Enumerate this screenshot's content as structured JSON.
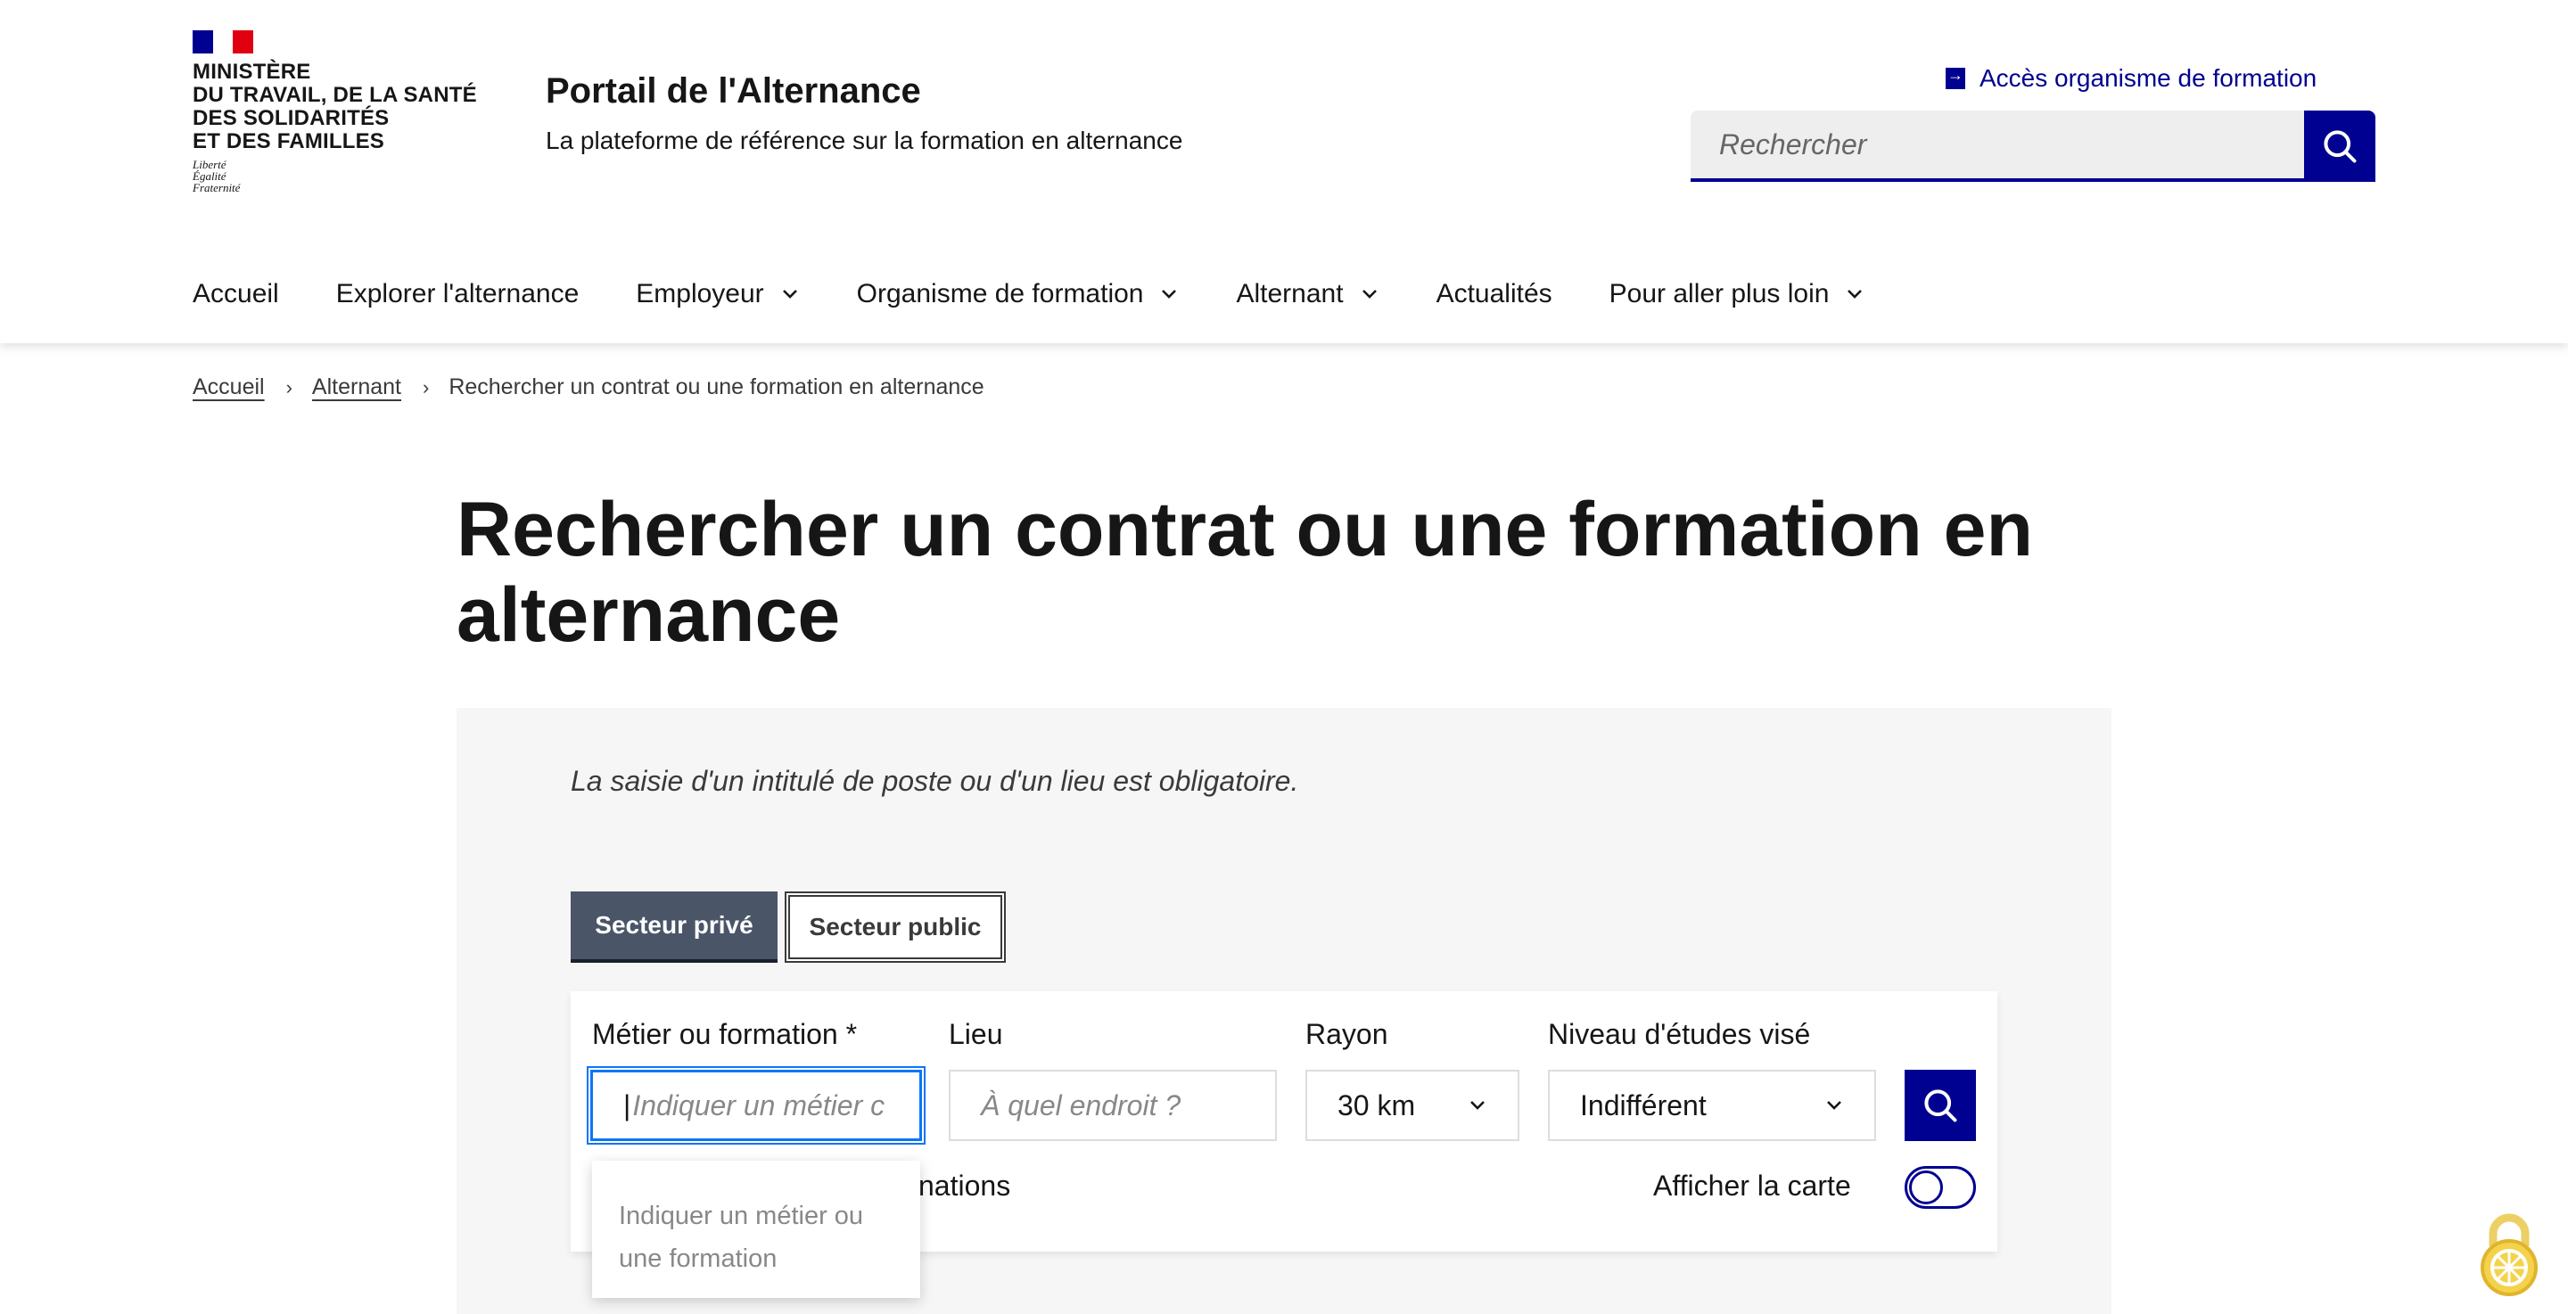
{
  "header": {
    "ministry": "MINISTÈRE\nDU TRAVAIL, DE LA SANTÉ\nDES SOLIDARITÉS\nET DES FAMILLES",
    "ministry_lines": [
      "MINISTÈRE",
      "DU TRAVAIL, DE LA SANTÉ",
      "DES SOLIDARITÉS",
      "ET DES FAMILLES"
    ],
    "motto": [
      "Liberté",
      "Égalité",
      "Fraternité"
    ],
    "service_title": "Portail de l'Alternance",
    "service_tagline": "La plateforme de référence sur la formation en alternance",
    "org_access_label": "Accès organisme de formation",
    "search_placeholder": "Rechercher",
    "brand_color": "#000091"
  },
  "nav": {
    "items": [
      {
        "label": "Accueil",
        "has_dropdown": false
      },
      {
        "label": "Explorer l'alternance",
        "has_dropdown": false
      },
      {
        "label": "Employeur",
        "has_dropdown": true
      },
      {
        "label": "Organisme de formation",
        "has_dropdown": true
      },
      {
        "label": "Alternant",
        "has_dropdown": true
      },
      {
        "label": "Actualités",
        "has_dropdown": false
      },
      {
        "label": "Pour aller plus loin",
        "has_dropdown": true
      }
    ]
  },
  "breadcrumb": {
    "items": [
      "Accueil",
      "Alternant"
    ],
    "current": "Rechercher un contrat ou une formation en alternance"
  },
  "page": {
    "title": "Rechercher un contrat ou une formation en alternance"
  },
  "search_form": {
    "notice": "La saisie d'un intitulé de poste ou d'un lieu est obligatoire.",
    "tabs": [
      {
        "label": "Secteur privé",
        "active": true
      },
      {
        "label": "Secteur public",
        "active": false
      }
    ],
    "job_label": "Métier ou formation",
    "job_required_mark": "*",
    "job_placeholder": "Indiquer un métier ou une formation",
    "job_placeholder_visible": "Indiquer un métier c",
    "location_label": "Lieu",
    "location_placeholder": "À quel endroit ?",
    "radius_label": "Rayon",
    "radius_value": "30 km",
    "level_label": "Niveau d'études visé",
    "level_value": "Indifférent",
    "formations_text_partial": "nations",
    "map_label": "Afficher la carte",
    "map_toggle_on": false,
    "suggestion_lines": [
      "Indiquer un métier ou",
      "une formation"
    ]
  }
}
